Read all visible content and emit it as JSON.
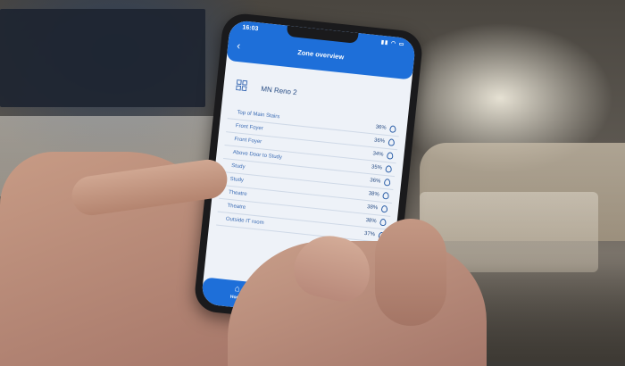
{
  "status": {
    "time": "16:03",
    "icons": "▮▮ ◠ ▭"
  },
  "app": {
    "title": "Zone overview",
    "back_icon": "chevron-left-icon"
  },
  "zone": {
    "name": "MN Reno 2",
    "icon": "grid-icon"
  },
  "rows": [
    {
      "label": "Top of Main Stairs",
      "value": "36%"
    },
    {
      "label": "Front Foyer",
      "value": "36%"
    },
    {
      "label": "Front Foyer",
      "value": "34%"
    },
    {
      "label": "Above Door to Study",
      "value": "35%"
    },
    {
      "label": "Study",
      "value": "36%"
    },
    {
      "label": "Study",
      "value": "38%"
    },
    {
      "label": "Theatre",
      "value": "38%"
    },
    {
      "label": "Theatre",
      "value": "38%"
    },
    {
      "label": "Outside IT room",
      "value": "37%"
    }
  ],
  "nav": {
    "home_label": "Home",
    "home_icon": "home-icon"
  },
  "colors": {
    "accent": "#1e6fd9",
    "text": "#274c84"
  }
}
